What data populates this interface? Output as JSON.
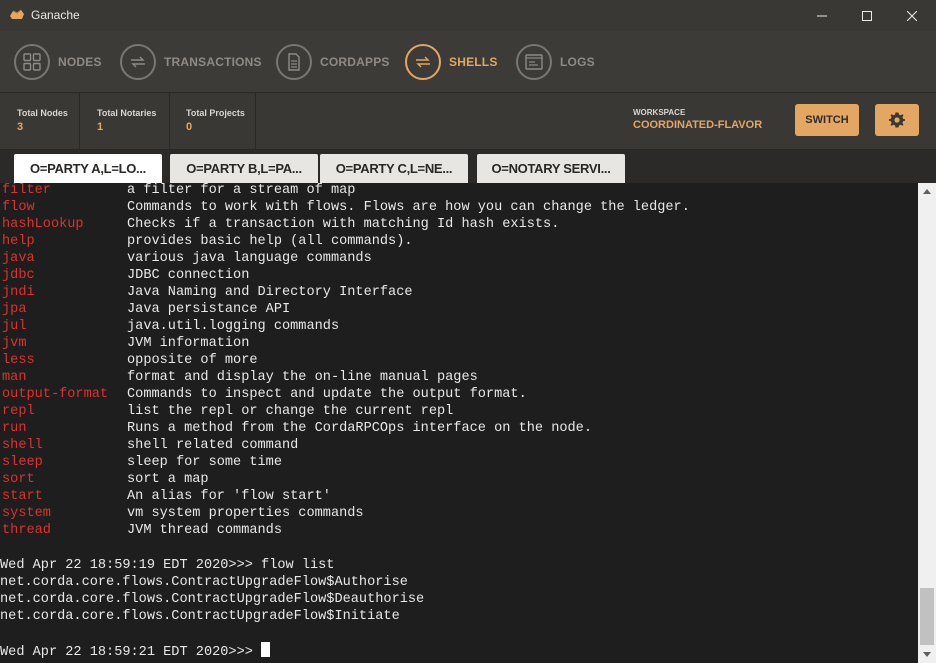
{
  "window": {
    "title": "Ganache",
    "minimize_icon": "minimize-icon",
    "maximize_icon": "maximize-icon",
    "close_icon": "close-icon"
  },
  "nav": {
    "items": [
      {
        "label": "NODES",
        "icon": "grid-icon"
      },
      {
        "label": "TRANSACTIONS",
        "icon": "swap-icon"
      },
      {
        "label": "CORDAPPS",
        "icon": "document-icon"
      },
      {
        "label": "SHELLS",
        "icon": "swap-icon",
        "active": true
      },
      {
        "label": "LOGS",
        "icon": "terminal-icon"
      }
    ]
  },
  "stats": {
    "total_nodes_label": "Total Nodes",
    "total_nodes_value": "3",
    "total_notaries_label": "Total Notaries",
    "total_notaries_value": "1",
    "total_projects_label": "Total Projects",
    "total_projects_value": "0",
    "workspace_label": "WORKSPACE",
    "workspace_value": "COORDINATED-FLAVOR",
    "switch_label": "SWITCH"
  },
  "tabs": [
    {
      "label": "O=PARTY A,L=LO...",
      "active": true
    },
    {
      "label": "O=PARTY B,L=PA..."
    },
    {
      "label": "O=PARTY C,L=NE..."
    },
    {
      "label": "O=NOTARY SERVI..."
    }
  ],
  "terminal": {
    "commands": [
      {
        "name": "filter",
        "desc": "a filter for a stream of map"
      },
      {
        "name": "flow",
        "desc": "Commands to work with flows. Flows are how you can change the ledger."
      },
      {
        "name": "hashLookup",
        "desc": "Checks if a transaction with matching Id hash exists."
      },
      {
        "name": "help",
        "desc": "provides basic help (all commands)."
      },
      {
        "name": "java",
        "desc": "various java language commands"
      },
      {
        "name": "jdbc",
        "desc": "JDBC connection"
      },
      {
        "name": "jndi",
        "desc": "Java Naming and Directory Interface"
      },
      {
        "name": "jpa",
        "desc": "Java persistance API"
      },
      {
        "name": "jul",
        "desc": "java.util.logging commands"
      },
      {
        "name": "jvm",
        "desc": "JVM information"
      },
      {
        "name": "less",
        "desc": "opposite of more"
      },
      {
        "name": "man",
        "desc": "format and display the on-line manual pages"
      },
      {
        "name": "output-format",
        "desc": "Commands to inspect and update the output format."
      },
      {
        "name": "repl",
        "desc": "list the repl or change the current repl"
      },
      {
        "name": "run",
        "desc": "Runs a method from the CordaRPCOps interface on the node."
      },
      {
        "name": "shell",
        "desc": "shell related command"
      },
      {
        "name": "sleep",
        "desc": "sleep for some time"
      },
      {
        "name": "sort",
        "desc": "sort a map"
      },
      {
        "name": "start",
        "desc": "An alias for 'flow start'"
      },
      {
        "name": "system",
        "desc": "vm system properties commands"
      },
      {
        "name": "thread",
        "desc": "JVM thread commands"
      }
    ],
    "prompt1": "Wed Apr 22 18:59:19 EDT 2020>>> flow list",
    "output": [
      "net.corda.core.flows.ContractUpgradeFlow$Authorise",
      "net.corda.core.flows.ContractUpgradeFlow$Deauthorise",
      "net.corda.core.flows.ContractUpgradeFlow$Initiate"
    ],
    "prompt2": "Wed Apr 22 18:59:21 EDT 2020>>> "
  },
  "colors": {
    "accent": "#e4a663",
    "command": "#e0312f",
    "background": "#1e1e1e"
  }
}
